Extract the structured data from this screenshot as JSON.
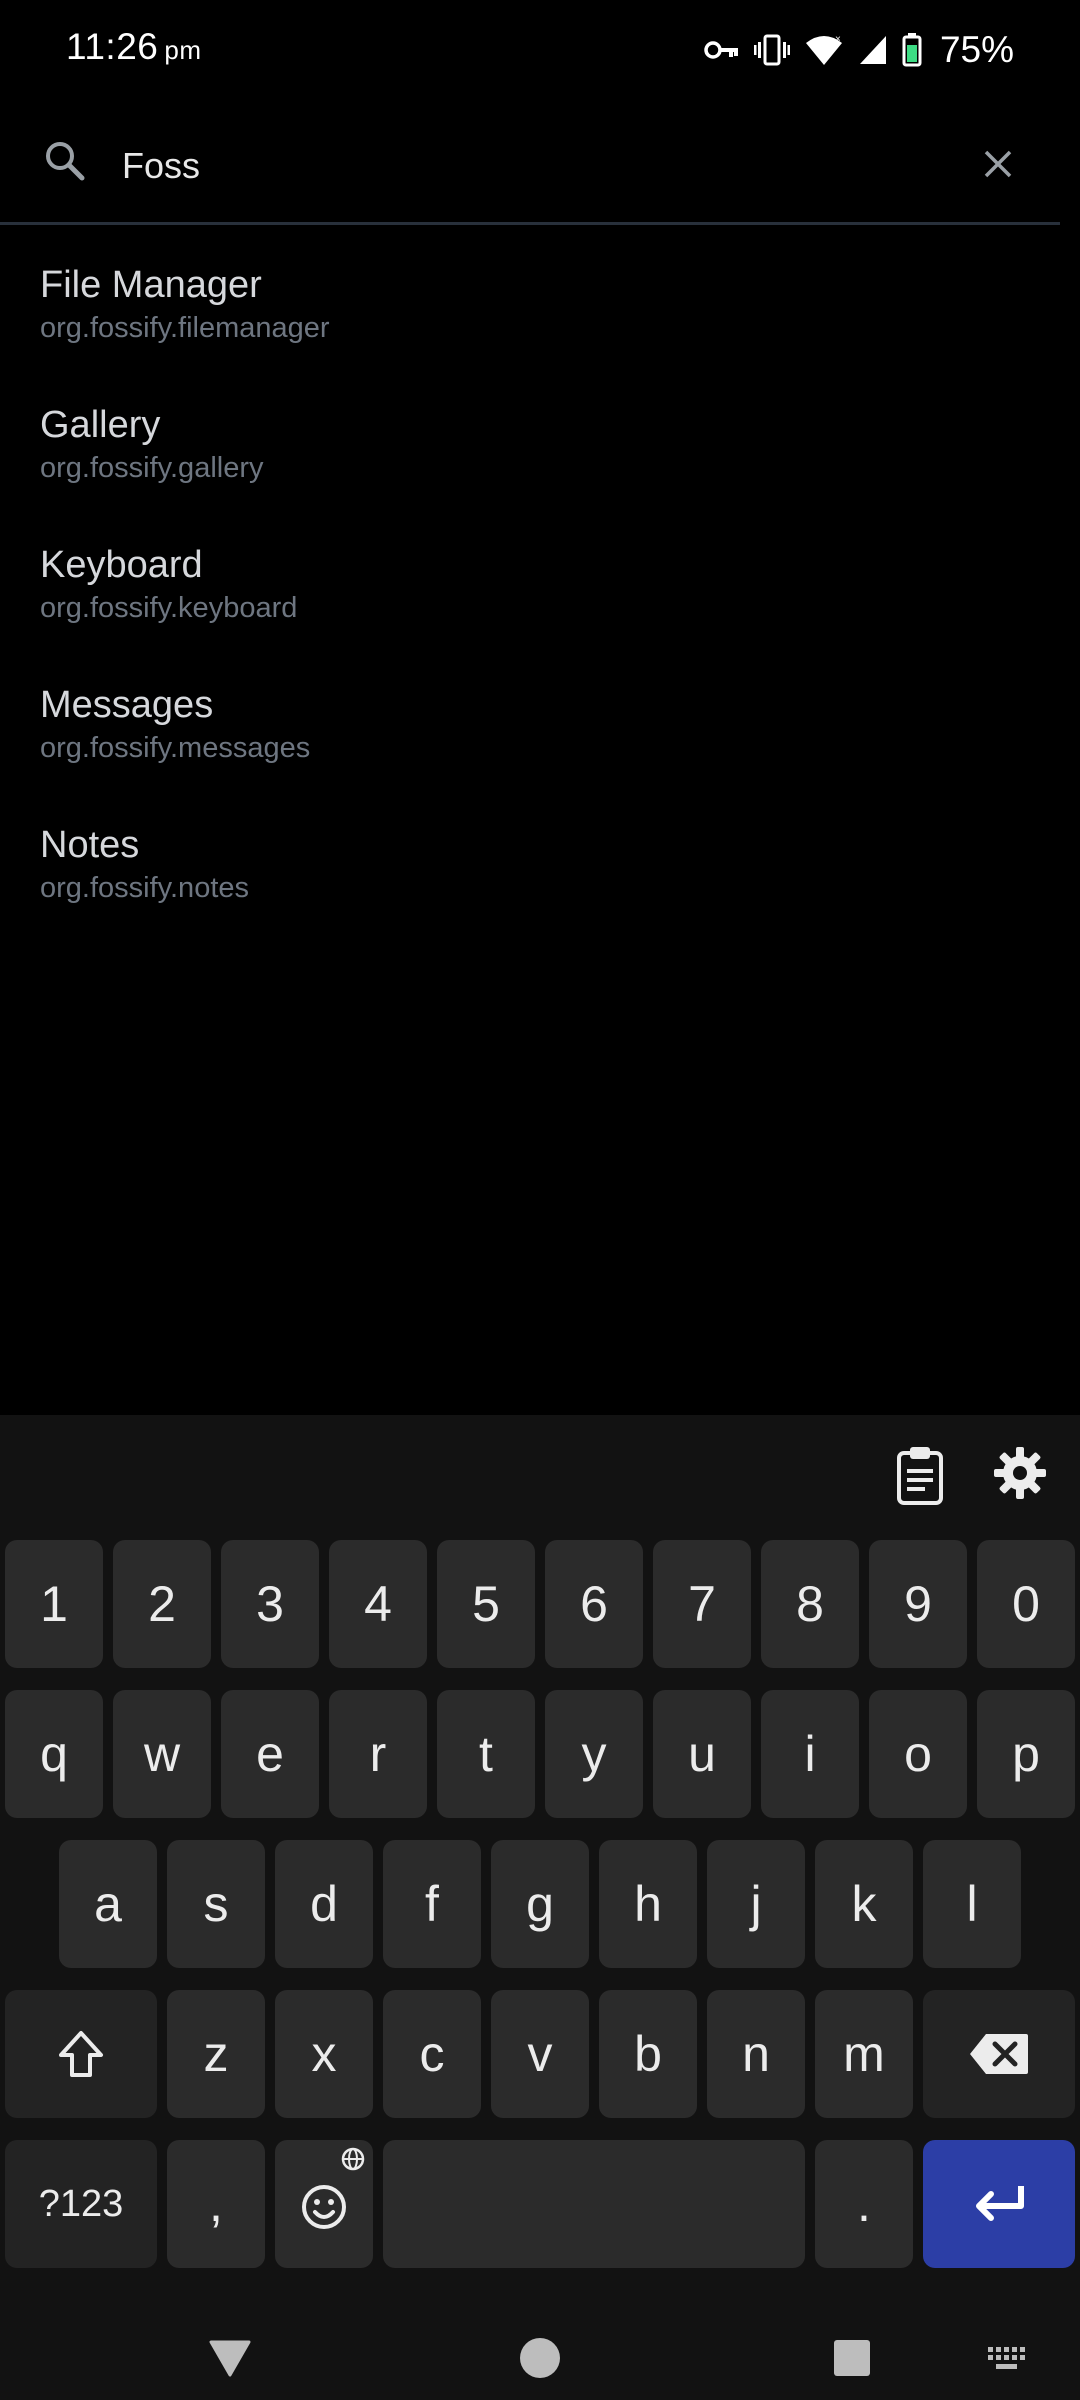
{
  "status_bar": {
    "time": "11:26",
    "ampm": "pm",
    "battery_percent": "75%",
    "icons": [
      "vpn-key-icon",
      "vibrate-icon",
      "wifi-icon",
      "cell-signal-icon",
      "battery-icon"
    ]
  },
  "search": {
    "value": "Foss",
    "icons": [
      "search-icon",
      "close-icon"
    ]
  },
  "results": [
    {
      "title": "File Manager",
      "package": "org.fossify.filemanager"
    },
    {
      "title": "Gallery",
      "package": "org.fossify.gallery"
    },
    {
      "title": "Keyboard",
      "package": "org.fossify.keyboard"
    },
    {
      "title": "Messages",
      "package": "org.fossify.messages"
    },
    {
      "title": "Notes",
      "package": "org.fossify.notes"
    }
  ],
  "keyboard": {
    "toolbar_icons": [
      "clipboard-icon",
      "settings-gear-icon"
    ],
    "number_row": [
      "1",
      "2",
      "3",
      "4",
      "5",
      "6",
      "7",
      "8",
      "9",
      "0"
    ],
    "row1": [
      "q",
      "w",
      "e",
      "r",
      "t",
      "y",
      "u",
      "i",
      "o",
      "p"
    ],
    "row2": [
      "a",
      "s",
      "d",
      "f",
      "g",
      "h",
      "j",
      "k",
      "l"
    ],
    "row3": [
      "z",
      "x",
      "c",
      "v",
      "b",
      "n",
      "m"
    ],
    "symbols_label": "?123",
    "comma": ",",
    "period": ".",
    "enter_color": "#2c3ea6"
  },
  "nav_bar": {
    "icons": [
      "back-triangle-icon",
      "home-circle-icon",
      "recents-square-icon",
      "keyboard-switch-icon"
    ]
  }
}
